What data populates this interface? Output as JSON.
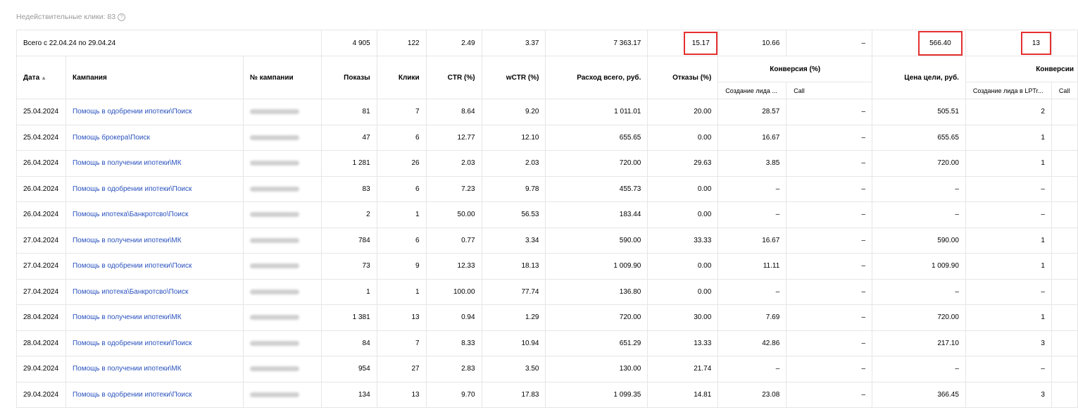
{
  "invalid_clicks_label": "Недействительные клики: 83",
  "help_icon_glyph": "?",
  "header": {
    "date": "Дата",
    "sort_arrow": "▲",
    "campaign": "Кампания",
    "campaign_no": "№ кампании",
    "impressions": "Показы",
    "clicks": "Клики",
    "ctr": "CTR (%)",
    "wctr": "wCTR (%)",
    "spend": "Расход всего, руб.",
    "bounces": "Отказы (%)",
    "conversion_pct": "Конверсия (%)",
    "goal_price": "Цена цели, руб.",
    "conversions": "Конверсии",
    "sub_lead": "Создание лида ...",
    "sub_call": "Call",
    "sub_lead2": "Создание лида в LPTr...",
    "sub_call2": "Call"
  },
  "total": {
    "label": "Всего с 22.04.24 по 29.04.24",
    "impressions": "4 905",
    "clicks": "122",
    "ctr": "2.49",
    "wctr": "3.37",
    "spend": "7 363.17",
    "bounces": "15.17",
    "conv_lead": "10.66",
    "conv_call": "–",
    "goal_price": "566.40",
    "conversions_lead": "13"
  },
  "rows": [
    {
      "date": "25.04.2024",
      "campaign": "Помощь в одобрении ипотеки\\Поиск",
      "impressions": "81",
      "clicks": "7",
      "ctr": "8.64",
      "wctr": "9.20",
      "spend": "1 011.01",
      "bounces": "20.00",
      "conv_lead": "28.57",
      "conv_call": "–",
      "goal_price": "505.51",
      "conversions_lead": "2"
    },
    {
      "date": "25.04.2024",
      "campaign": "Помощь брокера\\Поиск",
      "impressions": "47",
      "clicks": "6",
      "ctr": "12.77",
      "wctr": "12.10",
      "spend": "655.65",
      "bounces": "0.00",
      "conv_lead": "16.67",
      "conv_call": "–",
      "goal_price": "655.65",
      "conversions_lead": "1"
    },
    {
      "date": "26.04.2024",
      "campaign": "Помощь в получении ипотеки\\МК",
      "impressions": "1 281",
      "clicks": "26",
      "ctr": "2.03",
      "wctr": "2.03",
      "spend": "720.00",
      "bounces": "29.63",
      "conv_lead": "3.85",
      "conv_call": "–",
      "goal_price": "720.00",
      "conversions_lead": "1"
    },
    {
      "date": "26.04.2024",
      "campaign": "Помощь в одобрении ипотеки\\Поиск",
      "impressions": "83",
      "clicks": "6",
      "ctr": "7.23",
      "wctr": "9.78",
      "spend": "455.73",
      "bounces": "0.00",
      "conv_lead": "–",
      "conv_call": "–",
      "goal_price": "–",
      "conversions_lead": "–"
    },
    {
      "date": "26.04.2024",
      "campaign": "Помощь ипотека\\Банкротсво\\Поиск",
      "impressions": "2",
      "clicks": "1",
      "ctr": "50.00",
      "wctr": "56.53",
      "spend": "183.44",
      "bounces": "0.00",
      "conv_lead": "–",
      "conv_call": "–",
      "goal_price": "–",
      "conversions_lead": "–"
    },
    {
      "date": "27.04.2024",
      "campaign": "Помощь в получении ипотеки\\МК",
      "impressions": "784",
      "clicks": "6",
      "ctr": "0.77",
      "wctr": "3.34",
      "spend": "590.00",
      "bounces": "33.33",
      "conv_lead": "16.67",
      "conv_call": "–",
      "goal_price": "590.00",
      "conversions_lead": "1"
    },
    {
      "date": "27.04.2024",
      "campaign": "Помощь в одобрении ипотеки\\Поиск",
      "impressions": "73",
      "clicks": "9",
      "ctr": "12.33",
      "wctr": "18.13",
      "spend": "1 009.90",
      "bounces": "0.00",
      "conv_lead": "11.11",
      "conv_call": "–",
      "goal_price": "1 009.90",
      "conversions_lead": "1"
    },
    {
      "date": "27.04.2024",
      "campaign": "Помощь ипотека\\Банкротсво\\Поиск",
      "impressions": "1",
      "clicks": "1",
      "ctr": "100.00",
      "wctr": "77.74",
      "spend": "136.80",
      "bounces": "0.00",
      "conv_lead": "–",
      "conv_call": "–",
      "goal_price": "–",
      "conversions_lead": "–"
    },
    {
      "date": "28.04.2024",
      "campaign": "Помощь в получении ипотеки\\МК",
      "impressions": "1 381",
      "clicks": "13",
      "ctr": "0.94",
      "wctr": "1.29",
      "spend": "720.00",
      "bounces": "30.00",
      "conv_lead": "7.69",
      "conv_call": "–",
      "goal_price": "720.00",
      "conversions_lead": "1"
    },
    {
      "date": "28.04.2024",
      "campaign": "Помощь в одобрении ипотеки\\Поиск",
      "impressions": "84",
      "clicks": "7",
      "ctr": "8.33",
      "wctr": "10.94",
      "spend": "651.29",
      "bounces": "13.33",
      "conv_lead": "42.86",
      "conv_call": "–",
      "goal_price": "217.10",
      "conversions_lead": "3"
    },
    {
      "date": "29.04.2024",
      "campaign": "Помощь в получении ипотеки\\МК",
      "impressions": "954",
      "clicks": "27",
      "ctr": "2.83",
      "wctr": "3.50",
      "spend": "130.00",
      "bounces": "21.74",
      "conv_lead": "–",
      "conv_call": "–",
      "goal_price": "–",
      "conversions_lead": "–"
    },
    {
      "date": "29.04.2024",
      "campaign": "Помощь в одобрении ипотеки\\Поиск",
      "impressions": "134",
      "clicks": "13",
      "ctr": "9.70",
      "wctr": "17.83",
      "spend": "1 099.35",
      "bounces": "14.81",
      "conv_lead": "23.08",
      "conv_call": "–",
      "goal_price": "366.45",
      "conversions_lead": "3"
    }
  ],
  "colors": {
    "link": "#2a52be",
    "highlight_box": "#e53030",
    "border": "#e6e6e6",
    "muted_text": "#999999"
  }
}
